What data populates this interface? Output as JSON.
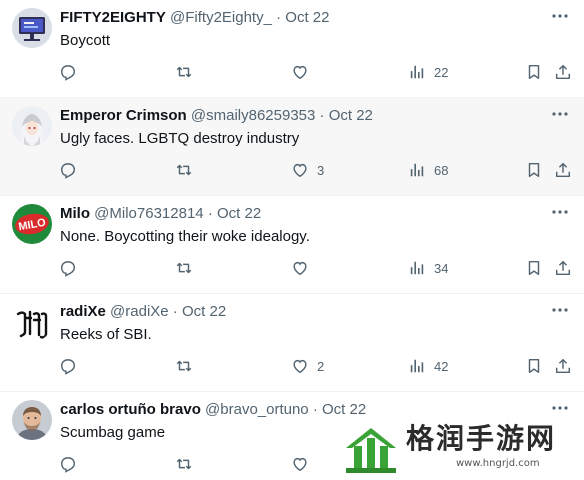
{
  "tweets": [
    {
      "name": "FIFTY2EIGHTY",
      "handle": "@Fifty2Eighty_",
      "dot": "·",
      "date": "Oct 22",
      "text": "Boycott",
      "likes": "",
      "views": "22",
      "avatar": "monitor-avatar"
    },
    {
      "name": "Emperor Crimson",
      "handle": "@smaily86259353",
      "dot": "·",
      "date": "Oct 22",
      "text": "Ugly faces. LGBTQ destroy industry",
      "likes": "3",
      "views": "68",
      "avatar": "anime-avatar"
    },
    {
      "name": "Milo",
      "handle": "@Milo76312814",
      "dot": "·",
      "date": "Oct 22",
      "text": "None. Boycotting their woke idealogy.",
      "likes": "",
      "views": "34",
      "avatar": "milo-logo-avatar"
    },
    {
      "name": "radiXe",
      "handle": "@radiXe",
      "dot": "·",
      "date": "Oct 22",
      "text": "Reeks of SBI.",
      "likes": "2",
      "views": "42",
      "avatar": "gothic-letters-avatar"
    },
    {
      "name": "carlos ortuño bravo",
      "handle": "@bravo_ortuno",
      "dot": "·",
      "date": "Oct 22",
      "text": "Scumbag game",
      "likes": "",
      "views": "",
      "avatar": "man-photo-avatar"
    }
  ],
  "watermark": {
    "text": "格润手游网",
    "url": "www.hngrjd.com"
  },
  "colors": {
    "text": "#0f1419",
    "secondary": "#536471",
    "highlight_bg": "#f7f7f7",
    "divider": "#eff3f4",
    "watermark_green": "#3aa335"
  }
}
